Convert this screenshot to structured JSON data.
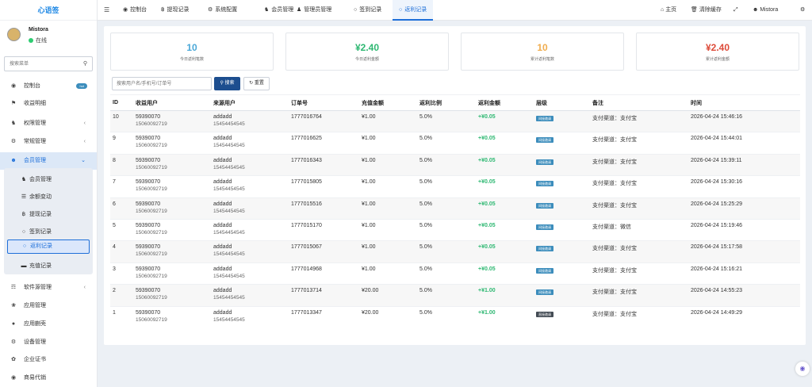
{
  "app": {
    "title": "心语签"
  },
  "user": {
    "name": "Mistora",
    "status": "在线"
  },
  "sidebar": {
    "search_placeholder": "搜索菜单",
    "hot_badge": "hot",
    "items": [
      {
        "label": "控制台",
        "icon": "dashboard-icon"
      },
      {
        "label": "收益明细",
        "icon": "flag-icon"
      },
      {
        "label": "权限管理",
        "icon": "group-icon"
      },
      {
        "label": "常规管理",
        "icon": "cogs-icon"
      },
      {
        "label": "会员管理",
        "icon": "user-circle-icon"
      },
      {
        "label": "软件源管理",
        "icon": "sitemap-icon"
      },
      {
        "label": "应用管理",
        "icon": "leaf-icon"
      },
      {
        "label": "应用蒯壳",
        "icon": "apple-icon"
      },
      {
        "label": "设备管理",
        "icon": "gear-icon"
      },
      {
        "label": "企业证书",
        "icon": "certificate-icon"
      },
      {
        "label": "商易代销",
        "icon": "store-icon"
      }
    ],
    "submenu": [
      {
        "label": "会员管理",
        "icon": "users-icon"
      },
      {
        "label": "余额变动",
        "icon": "list-icon"
      },
      {
        "label": "提现记录",
        "icon": "bitcoin-icon"
      },
      {
        "label": "签到记录",
        "icon": "circle-icon"
      },
      {
        "label": "返利记录",
        "icon": "circle-icon"
      },
      {
        "label": "充值记录",
        "icon": "credit-card-icon"
      }
    ]
  },
  "topbar": {
    "tabs": [
      {
        "label": "控制台",
        "icon": "dashboard-icon"
      },
      {
        "label": "提现记录",
        "icon": "bitcoin-icon"
      },
      {
        "label": "系统配置",
        "icon": "cog-icon"
      },
      {
        "label": "会员管理",
        "icon": "users-icon"
      },
      {
        "label": "管理员管理",
        "icon": "user-icon"
      },
      {
        "label": "签到记录",
        "icon": "circle-icon"
      },
      {
        "label": "返利记录",
        "icon": "circle-icon"
      }
    ],
    "home": "主页",
    "clear_cache": "清除缓存",
    "username": "Mistora"
  },
  "stats": [
    {
      "value": "10",
      "label": "今日返利笔数",
      "color": "#4aa8d8"
    },
    {
      "value": "¥2.40",
      "label": "今日返利金额",
      "color": "#2eb872"
    },
    {
      "value": "10",
      "label": "累计返利笔数",
      "color": "#f0ad4e"
    },
    {
      "value": "¥2.40",
      "label": "累计返利金额",
      "color": "#dd4b39"
    }
  ],
  "search": {
    "placeholder": "搜索用户名/手机号/订单号",
    "search_btn": "搜索",
    "reset_btn": "重置"
  },
  "table": {
    "headers": [
      "ID",
      "收益用户",
      "来源用户",
      "订单号",
      "充值金额",
      "返利比例",
      "返利金额",
      "层级",
      "备注",
      "时间"
    ],
    "rows": [
      {
        "id": "10",
        "u1": "59390070",
        "u1p": "15060092719",
        "u2": "addadd",
        "u2p": "15454454545",
        "order": "1777016764",
        "pay": "¥1.00",
        "rate": "5.0%",
        "amt": "+¥0.05",
        "lvl": "间接邀请",
        "note": "支付渠道：支付宝",
        "time": "2026-04-24 15:46:16"
      },
      {
        "id": "9",
        "u1": "59390070",
        "u1p": "15060092719",
        "u2": "addadd",
        "u2p": "15454454545",
        "order": "1777016625",
        "pay": "¥1.00",
        "rate": "5.0%",
        "amt": "+¥0.05",
        "lvl": "间接邀请",
        "note": "支付渠道：支付宝",
        "time": "2026-04-24 15:44:01"
      },
      {
        "id": "8",
        "u1": "59390070",
        "u1p": "15060092719",
        "u2": "addadd",
        "u2p": "15454454545",
        "order": "1777016343",
        "pay": "¥1.00",
        "rate": "5.0%",
        "amt": "+¥0.05",
        "lvl": "间接邀请",
        "note": "支付渠道：支付宝",
        "time": "2026-04-24 15:39:11"
      },
      {
        "id": "7",
        "u1": "59390070",
        "u1p": "15060092719",
        "u2": "addadd",
        "u2p": "15454454545",
        "order": "1777015805",
        "pay": "¥1.00",
        "rate": "5.0%",
        "amt": "+¥0.05",
        "lvl": "间接邀请",
        "note": "支付渠道：支付宝",
        "time": "2026-04-24 15:30:16"
      },
      {
        "id": "6",
        "u1": "59390070",
        "u1p": "15060092719",
        "u2": "addadd",
        "u2p": "15454454545",
        "order": "1777015516",
        "pay": "¥1.00",
        "rate": "5.0%",
        "amt": "+¥0.05",
        "lvl": "间接邀请",
        "note": "支付渠道：支付宝",
        "time": "2026-04-24 15:25:29"
      },
      {
        "id": "5",
        "u1": "59390070",
        "u1p": "15060092719",
        "u2": "addadd",
        "u2p": "15454454545",
        "order": "1777015170",
        "pay": "¥1.00",
        "rate": "5.0%",
        "amt": "+¥0.05",
        "lvl": "间接邀请",
        "note": "支付渠道：微信",
        "time": "2026-04-24 15:19:46"
      },
      {
        "id": "4",
        "u1": "59390070",
        "u1p": "15060092719",
        "u2": "addadd",
        "u2p": "15454454545",
        "order": "1777015067",
        "pay": "¥1.00",
        "rate": "5.0%",
        "amt": "+¥0.05",
        "lvl": "间接邀请",
        "note": "支付渠道：支付宝",
        "time": "2026-04-24 15:17:58"
      },
      {
        "id": "3",
        "u1": "59390070",
        "u1p": "15060092719",
        "u2": "addadd",
        "u2p": "15454454545",
        "order": "1777014968",
        "pay": "¥1.00",
        "rate": "5.0%",
        "amt": "+¥0.05",
        "lvl": "间接邀请",
        "note": "支付渠道：支付宝",
        "time": "2026-04-24 15:16:21"
      },
      {
        "id": "2",
        "u1": "59390070",
        "u1p": "15060092719",
        "u2": "addadd",
        "u2p": "15454454545",
        "order": "1777013714",
        "pay": "¥20.00",
        "rate": "5.0%",
        "amt": "+¥1.00",
        "lvl": "间接邀请",
        "note": "支付渠道：支付宝",
        "time": "2026-04-24 14:55:23"
      },
      {
        "id": "1",
        "u1": "59390070",
        "u1p": "15060092719",
        "u2": "addadd",
        "u2p": "15454454545",
        "order": "1777013347",
        "pay": "¥20.00",
        "rate": "5.0%",
        "amt": "+¥1.00",
        "lvl": "直接邀请",
        "note": "支付渠道：支付宝",
        "time": "2026-04-24 14:49:29"
      }
    ]
  },
  "colors": {
    "accent": "#1e6fd9",
    "indirect": "#3c8dbc",
    "direct": "#444c55",
    "positive": "#2eb872"
  }
}
